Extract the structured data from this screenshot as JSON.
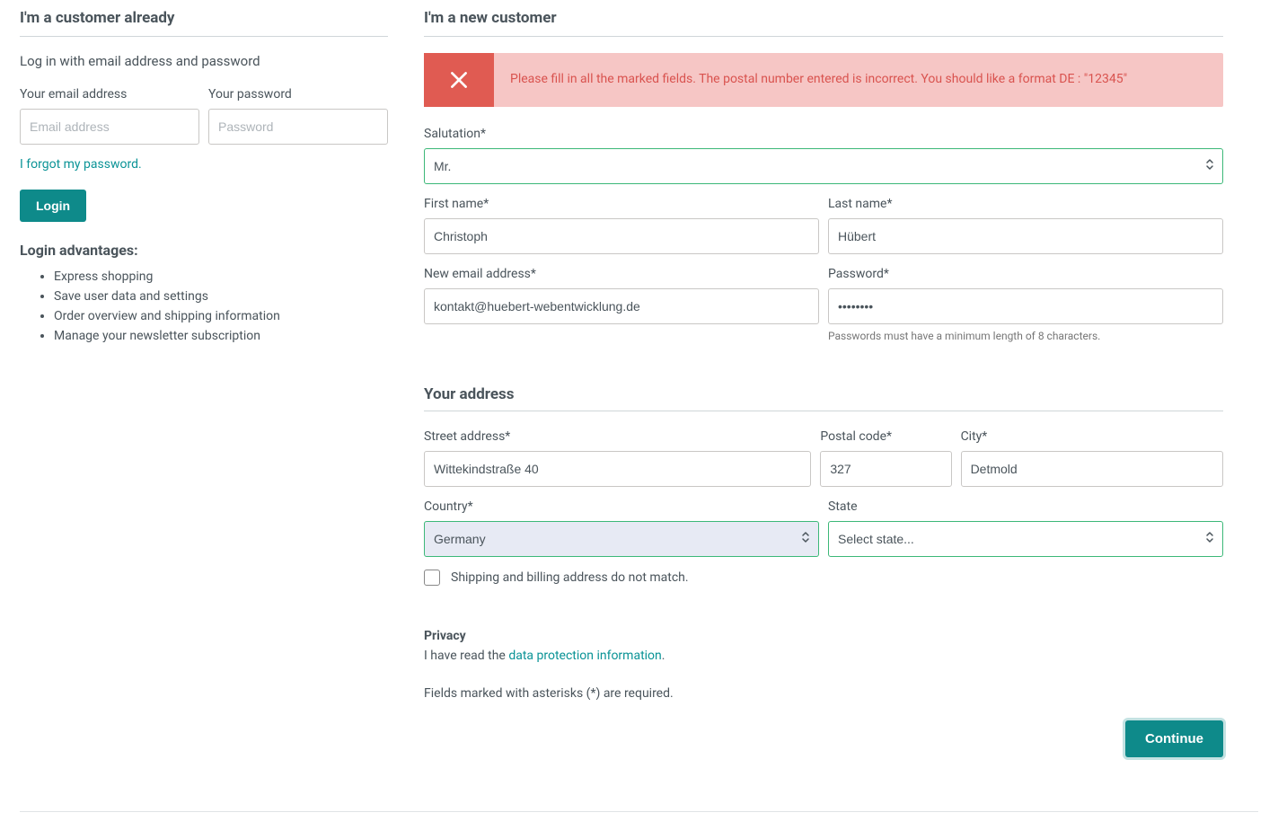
{
  "login": {
    "heading": "I'm a customer already",
    "subtext": "Log in with email address and password",
    "email_label": "Your email address",
    "email_placeholder": "Email address",
    "password_label": "Your password",
    "password_placeholder": "Password",
    "forgot_link": "I forgot my password.",
    "login_button": "Login",
    "advantages_title": "Login advantages:",
    "advantages": [
      "Express shopping",
      "Save user data and settings",
      "Order overview and shipping information",
      "Manage your newsletter subscription"
    ]
  },
  "register": {
    "heading": "I'm a new customer",
    "alert": "Please fill in all the marked fields. The postal number entered is incorrect. You should like a format DE : \"12345\"",
    "salutation_label": "Salutation*",
    "salutation_value": "Mr.",
    "firstname_label": "First name*",
    "firstname_value": "Christoph",
    "lastname_label": "Last name*",
    "lastname_value": "Hübert",
    "email_label": "New email address*",
    "email_value": "kontakt@huebert-webentwicklung.de",
    "password_label": "Password*",
    "password_value": "••••••••",
    "password_help": "Passwords must have a minimum length of 8 characters.",
    "address_heading": "Your address",
    "street_label": "Street address*",
    "street_value": "Wittekindstraße 40",
    "postal_label": "Postal code*",
    "postal_value": "327",
    "city_label": "City*",
    "city_value": "Detmold",
    "country_label": "Country*",
    "country_value": "Germany",
    "state_label": "State",
    "state_placeholder": "Select state...",
    "shipping_checkbox": "Shipping and billing address do not match.",
    "privacy_title": "Privacy",
    "privacy_prefix": "I have read the ",
    "privacy_link": "data protection information",
    "privacy_suffix": ".",
    "required_note": "Fields marked with asterisks (*) are required.",
    "continue_button": "Continue"
  }
}
